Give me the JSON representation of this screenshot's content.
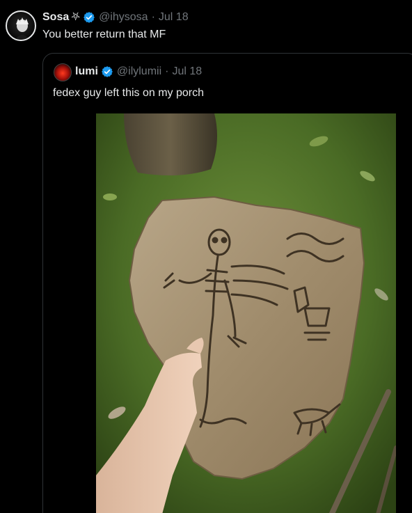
{
  "outer_post": {
    "name": "Sosa",
    "name_glyph": "⛧",
    "handle": "@ihysosa",
    "separator": "·",
    "date": "Jul 18",
    "text": "You better return that MF"
  },
  "quoted_post": {
    "name": "lumi",
    "handle": "@ilylumii",
    "separator": "·",
    "date": "Jul 18",
    "text": "fedex guy left this on my porch"
  },
  "icons": {
    "verified": "verified-badge-icon",
    "avatar_outer": "avatar",
    "avatar_quote": "avatar"
  },
  "colors": {
    "background": "#000000",
    "text": "#e7e9ea",
    "muted": "#71767b",
    "verified": "#1d9bf0",
    "border": "#2f3336"
  }
}
